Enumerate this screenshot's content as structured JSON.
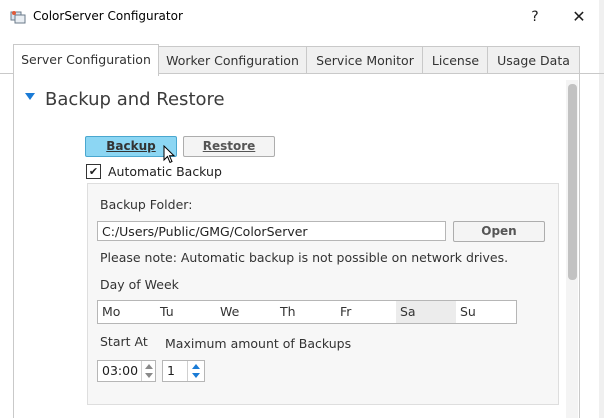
{
  "window": {
    "title": "ColorServer Configurator",
    "help_glyph": "?",
    "close_glyph": "✕"
  },
  "tabs": [
    {
      "label": "Server Configuration",
      "active": true
    },
    {
      "label": "Worker Configuration",
      "active": false
    },
    {
      "label": "Service Monitor",
      "active": false
    },
    {
      "label": "License",
      "active": false
    },
    {
      "label": "Usage Data",
      "active": false
    }
  ],
  "section": {
    "title": "Backup and Restore",
    "accent_color": "#1a7bd6"
  },
  "buttons": {
    "backup_label": "Backup",
    "restore_label": "Restore",
    "open_label": "Open",
    "hover_color": "#8cd6f3"
  },
  "automatic_backup": {
    "label": "Automatic Backup",
    "checked": true,
    "check_glyph": "✔"
  },
  "backup_folder": {
    "label": "Backup Folder:",
    "value": "C:/Users/Public/GMG/ColorServer"
  },
  "note": "Please note: Automatic backup is not possible on network drives.",
  "day_of_week": {
    "label": "Day of Week",
    "days": [
      "Mo",
      "Tu",
      "We",
      "Th",
      "Fr",
      "Sa",
      "Su"
    ],
    "selected": "Sa"
  },
  "start_at": {
    "label": "Start At",
    "value": "03:00"
  },
  "max_backups": {
    "label": "Maximum amount of Backups",
    "value": "1"
  }
}
